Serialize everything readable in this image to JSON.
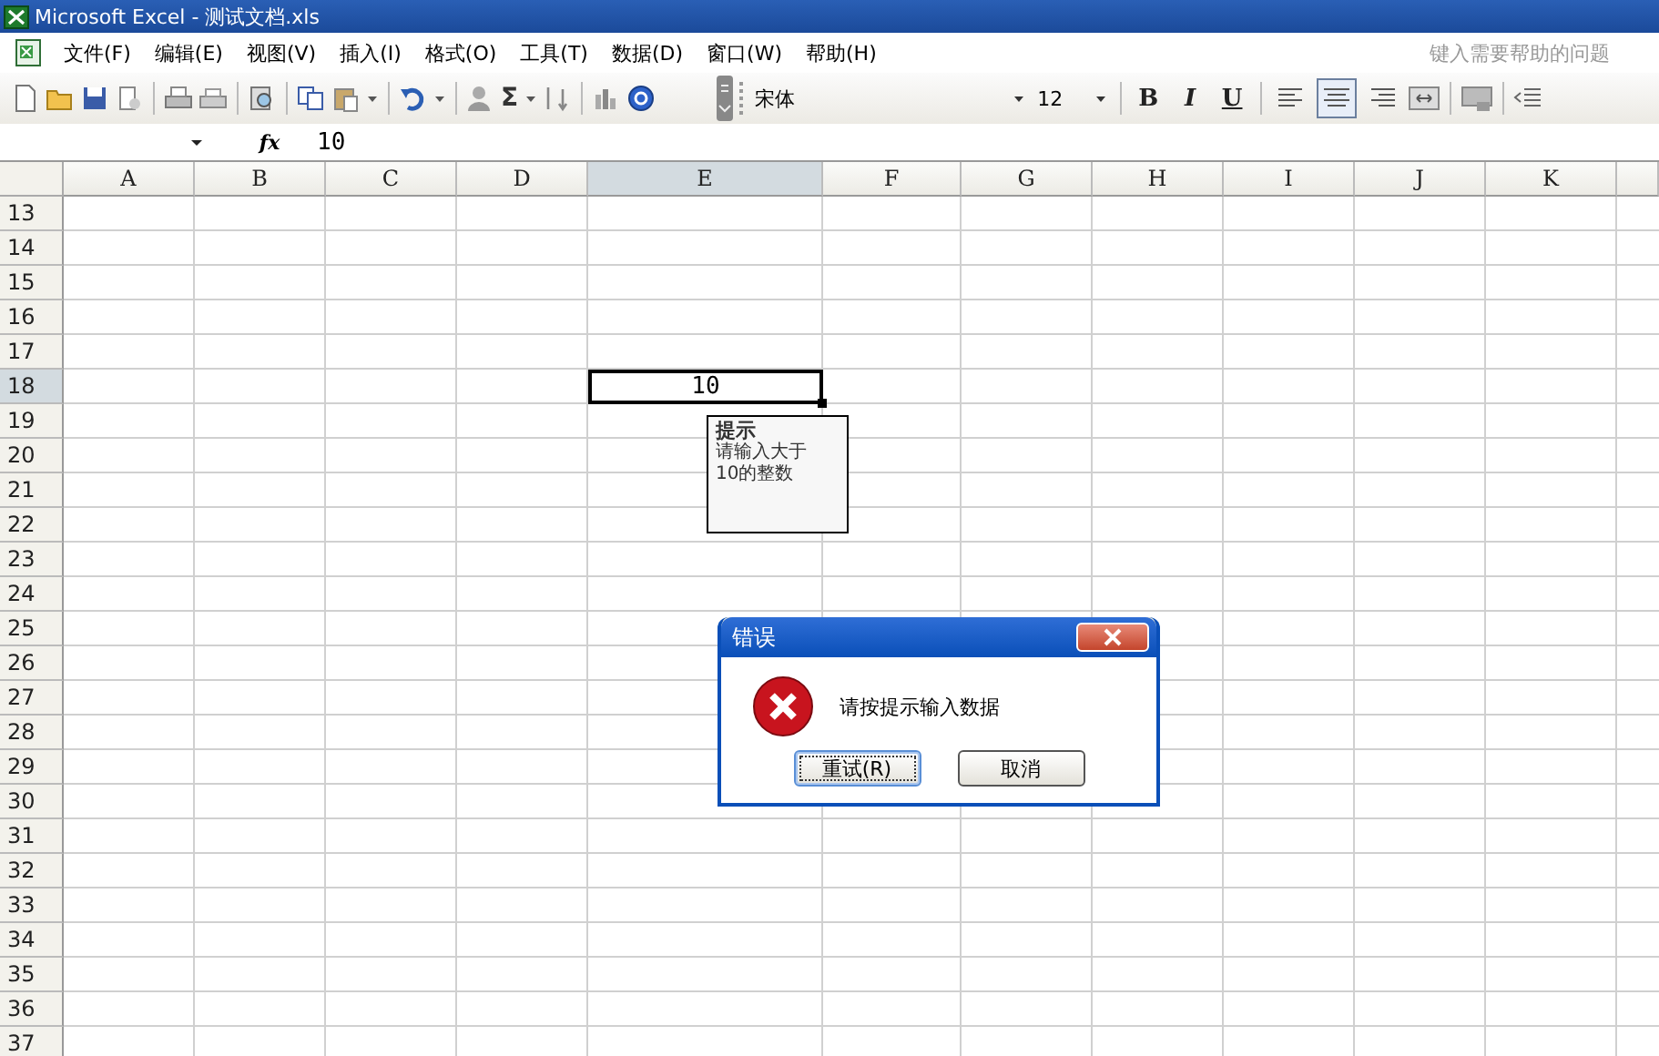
{
  "window": {
    "title": "Microsoft Excel - 测试文档.xls"
  },
  "menu": [
    {
      "label": "文件(F)"
    },
    {
      "label": "编辑(E)"
    },
    {
      "label": "视图(V)"
    },
    {
      "label": "插入(I)"
    },
    {
      "label": "格式(O)"
    },
    {
      "label": "工具(T)"
    },
    {
      "label": "数据(D)"
    },
    {
      "label": "窗口(W)"
    },
    {
      "label": "帮助(H)"
    }
  ],
  "help_search": {
    "placeholder": "键入需要帮助的问题"
  },
  "toolbar": {
    "sum_label": "Σ",
    "font_name": "宋体",
    "font_size": "12",
    "format_buttons": [
      {
        "label": "B",
        "kind": "bold"
      },
      {
        "label": "I",
        "kind": "italic"
      },
      {
        "label": "U",
        "kind": "underline"
      }
    ],
    "align_buttons": [
      {
        "selected": false
      },
      {
        "selected": true
      },
      {
        "selected": false
      }
    ]
  },
  "formula_bar": {
    "fx_label": "fx",
    "value": "10"
  },
  "columns": [
    {
      "label": "A",
      "selected": false
    },
    {
      "label": "B",
      "selected": false
    },
    {
      "label": "C",
      "selected": false
    },
    {
      "label": "D",
      "selected": false
    },
    {
      "label": "E",
      "selected": true
    },
    {
      "label": "F",
      "selected": false
    },
    {
      "label": "G",
      "selected": false
    },
    {
      "label": "H",
      "selected": false
    },
    {
      "label": "I",
      "selected": false
    },
    {
      "label": "J",
      "selected": false
    },
    {
      "label": "K",
      "selected": false
    }
  ],
  "rows": [
    {
      "label": "13",
      "selected": false
    },
    {
      "label": "14",
      "selected": false
    },
    {
      "label": "15",
      "selected": false
    },
    {
      "label": "16",
      "selected": false
    },
    {
      "label": "17",
      "selected": false
    },
    {
      "label": "18",
      "selected": true
    },
    {
      "label": "19",
      "selected": false
    },
    {
      "label": "20",
      "selected": false
    },
    {
      "label": "21",
      "selected": false
    },
    {
      "label": "22",
      "selected": false
    },
    {
      "label": "23",
      "selected": false
    },
    {
      "label": "24",
      "selected": false
    },
    {
      "label": "25",
      "selected": false
    },
    {
      "label": "26",
      "selected": false
    },
    {
      "label": "27",
      "selected": false
    },
    {
      "label": "28",
      "selected": false
    },
    {
      "label": "29",
      "selected": false
    },
    {
      "label": "30",
      "selected": false
    },
    {
      "label": "31",
      "selected": false
    },
    {
      "label": "32",
      "selected": false
    },
    {
      "label": "33",
      "selected": false
    },
    {
      "label": "34",
      "selected": false
    },
    {
      "label": "35",
      "selected": false
    },
    {
      "label": "36",
      "selected": false
    },
    {
      "label": "37",
      "selected": false
    }
  ],
  "active_cell": {
    "value": "10"
  },
  "input_message": {
    "title": "提示",
    "text": "请输入大于10的整数"
  },
  "dialog": {
    "title": "错误",
    "message": "请按提示输入数据",
    "buttons": [
      {
        "label": "重试(R)",
        "default": true
      },
      {
        "label": "取消",
        "default": false
      }
    ]
  }
}
